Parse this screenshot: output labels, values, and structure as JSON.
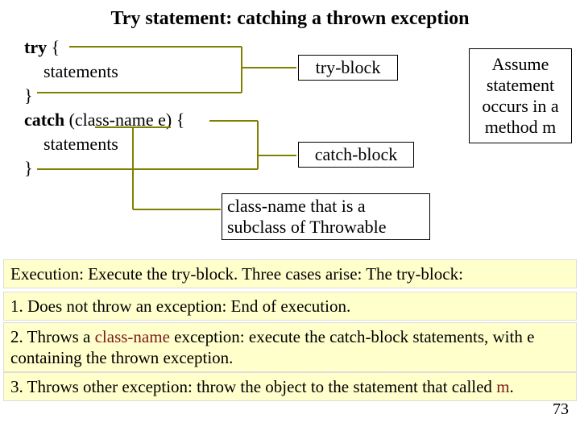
{
  "title": "Try statement: catching a thrown exception",
  "code": {
    "try_kw": "try",
    "brace_open": " {",
    "stmts1": "statements",
    "brace_close1": "}",
    "catch_kw": "catch",
    "catch_params": "   (class-name  e) {",
    "stmts2": "statements",
    "brace_close2": "}"
  },
  "labels": {
    "try_block": "try-block",
    "catch_block": "catch-block",
    "subclass": "class-name that is a subclass of Throwable",
    "assume": "Assume statement occurs in a method m"
  },
  "exec": {
    "intro": "Execution: Execute the try-block. Three cases arise: The try-block:",
    "case1": "1. Does not throw an exception: End of execution.",
    "case2a": "2. Throws a ",
    "case2_cn": "class-name",
    "case2b": " exception: execute the catch-block statements, with e containing the thrown exception.",
    "case3a": "3. Throws other exception: throw the object to the statement that called ",
    "case3_m": "m",
    "case3b": "."
  },
  "page": "73"
}
